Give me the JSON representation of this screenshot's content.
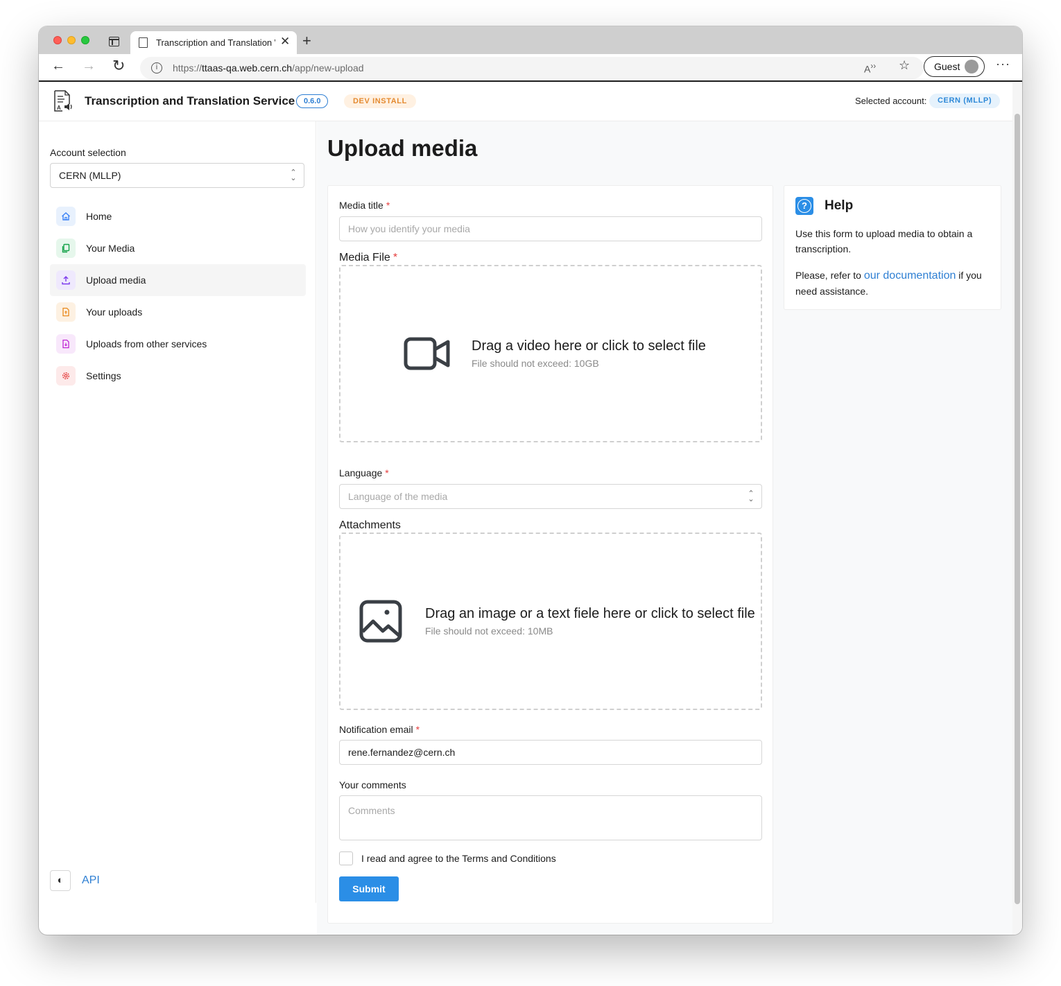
{
  "browser": {
    "tab_title": "Transcription and Translation W",
    "new_tab": "+",
    "url_prefix": "https://",
    "url_host": "ttaas-qa.web.cern.ch",
    "url_path": "/app/new-upload",
    "profile_label": "Guest",
    "more_label": "···"
  },
  "header": {
    "app_title": "Transcription and Translation Service",
    "version": "0.6.0",
    "dev_badge": "DEV INSTALL",
    "selected_account_label": "Selected account:",
    "selected_account": "CERN (MLLP)"
  },
  "sidebar": {
    "account_label": "Account selection",
    "account_value": "CERN (MLLP)",
    "items": [
      {
        "label": "Home",
        "icon": "home-icon",
        "color": "#3b82f6",
        "bg": "#e8f1fd"
      },
      {
        "label": "Your Media",
        "icon": "copy-icon",
        "color": "#16a34a",
        "bg": "#e6f7ec"
      },
      {
        "label": "Upload media",
        "icon": "upload-icon",
        "color": "#7c3aed",
        "bg": "#efe9fd"
      },
      {
        "label": "Your uploads",
        "icon": "file-upload-icon",
        "color": "#ea8a1e",
        "bg": "#fdf1e2"
      },
      {
        "label": "Uploads from other services",
        "icon": "file-import-icon",
        "color": "#c026d3",
        "bg": "#f8e8fb"
      },
      {
        "label": "Settings",
        "icon": "gear-icon",
        "color": "#e53e3e",
        "bg": "#fdeaea"
      }
    ],
    "active_index": 2,
    "api_label": "API"
  },
  "main": {
    "page_title": "Upload media",
    "form": {
      "media_title_label": "Media title",
      "media_title_placeholder": "How you identify your media",
      "media_file_label": "Media File",
      "media_file_title": "Drag a video here or click to select file",
      "media_file_sub": "File should not exceed: 10GB",
      "language_label": "Language",
      "language_placeholder": "Language of the media",
      "attachments_label": "Attachments",
      "attachments_title": "Drag an image or a text fiele here or click to select file",
      "attachments_sub": "File should not exceed: 10MB",
      "email_label": "Notification email",
      "email_value": "rene.fernandez@cern.ch",
      "comments_label": "Your comments",
      "comments_placeholder": "Comments",
      "terms_label": "I read and agree to the Terms and Conditions",
      "submit_label": "Submit",
      "required_mark": "*"
    },
    "help": {
      "title": "Help",
      "icon": "question-circle-icon",
      "p1": "Use this form to upload media to obtain a transcription.",
      "p2_before": "Please, refer to ",
      "p2_link": "our documentation",
      "p2_after": " if you need assistance."
    }
  },
  "colors": {
    "accent": "#2b8ee6",
    "required": "#e53e3e",
    "dev_badge": "#e48a30"
  }
}
